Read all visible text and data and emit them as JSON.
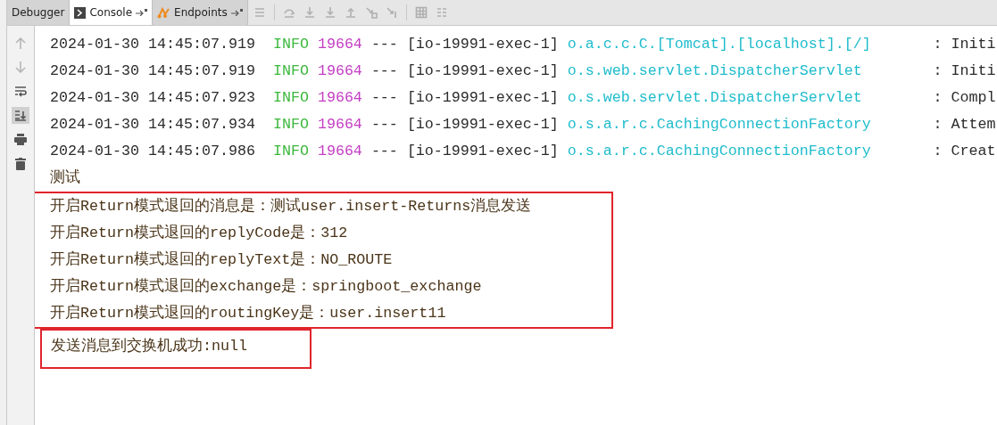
{
  "tabs": [
    {
      "label": "Debugger",
      "selected": false,
      "kind": "plain"
    },
    {
      "label": "Console",
      "selected": true,
      "kind": "console"
    },
    {
      "label": "Endpoints",
      "selected": false,
      "kind": "endpoints"
    }
  ],
  "log_lines": [
    {
      "time": "2024-01-30 14:45:07.919",
      "level": "INFO",
      "pid": "19664",
      "sep": "---",
      "thread": "[io-19991-exec-1]",
      "logger": "o.a.c.c.C.[Tomcat].[localhost].[/]",
      "message": ": Initi"
    },
    {
      "time": "2024-01-30 14:45:07.919",
      "level": "INFO",
      "pid": "19664",
      "sep": "---",
      "thread": "[io-19991-exec-1]",
      "logger": "o.s.web.servlet.DispatcherServlet",
      "message": ": Initi"
    },
    {
      "time": "2024-01-30 14:45:07.923",
      "level": "INFO",
      "pid": "19664",
      "sep": "---",
      "thread": "[io-19991-exec-1]",
      "logger": "o.s.web.servlet.DispatcherServlet",
      "message": ": Compl"
    },
    {
      "time": "2024-01-30 14:45:07.934",
      "level": "INFO",
      "pid": "19664",
      "sep": "---",
      "thread": "[io-19991-exec-1]",
      "logger": "o.s.a.r.c.CachingConnectionFactory",
      "message": ": Attem"
    },
    {
      "time": "2024-01-30 14:45:07.986",
      "level": "INFO",
      "pid": "19664",
      "sep": "---",
      "thread": "[io-19991-exec-1]",
      "logger": "o.s.a.r.c.CachingConnectionFactory",
      "message": ": Creat"
    }
  ],
  "output_lines": [
    "测试"
  ],
  "highlighted_groups": [
    {
      "lines": [
        "开启Return模式退回的消息是：测试user.insert-Returns消息发送",
        "开启Return模式退回的replyCode是：312",
        "开启Return模式退回的replyText是：NO_ROUTE",
        "开启Return模式退回的exchange是：springboot_exchange",
        "开启Return模式退回的routingKey是：user.insert11"
      ]
    },
    {
      "lines": [
        "发送消息到交换机成功:null"
      ]
    }
  ]
}
